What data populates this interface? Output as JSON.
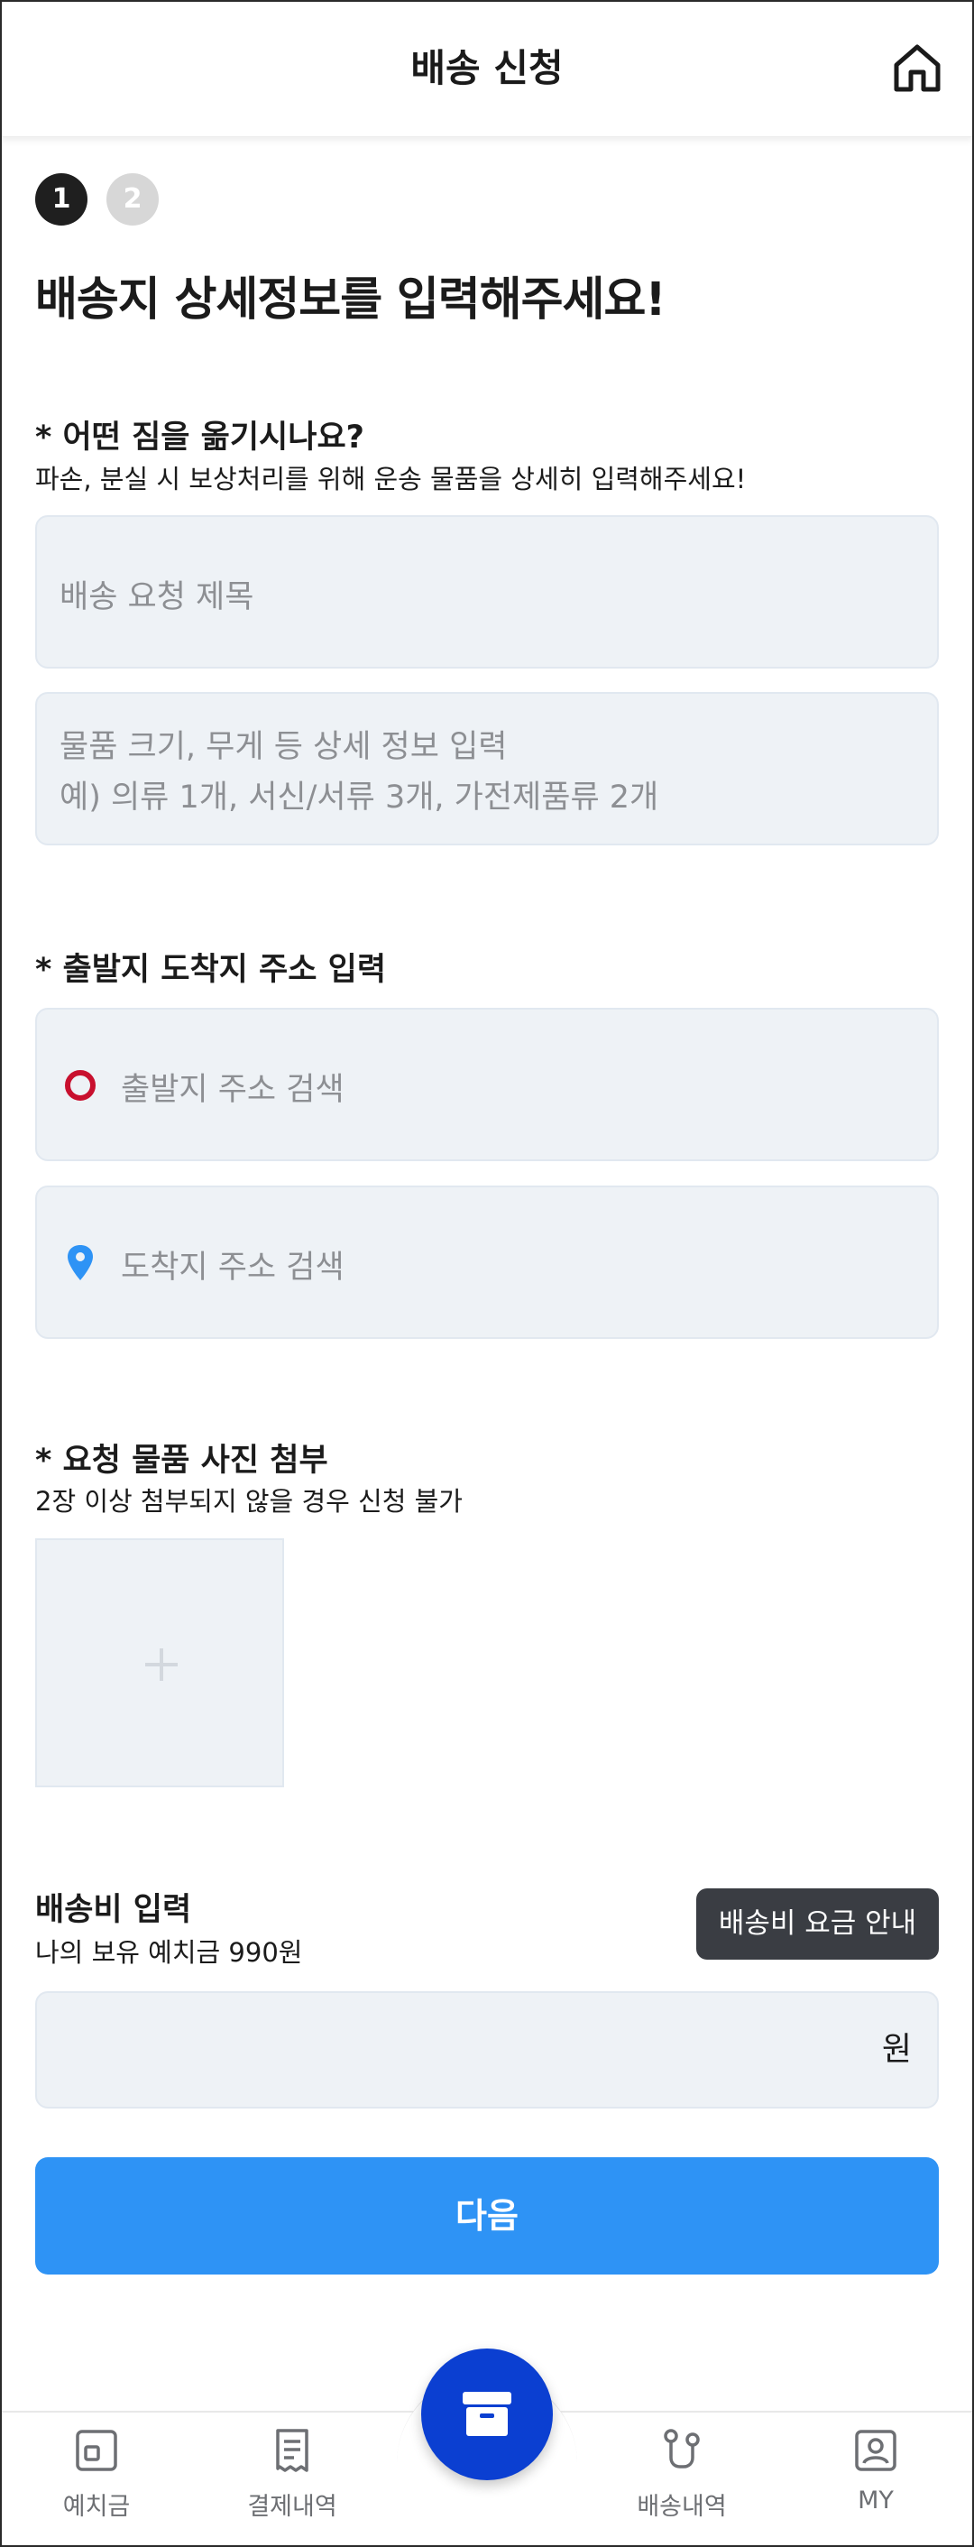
{
  "header": {
    "title": "배송 신청",
    "home_icon": "home-icon"
  },
  "steps": [
    "1",
    "2"
  ],
  "page_title": "배송지 상세정보를 입력해주세요!",
  "cargo": {
    "label": "* 어떤 짐을 옮기시나요?",
    "description": "파손, 분실 시 보상처리를 위해 운송 물품을 상세히 입력해주세요!",
    "title_placeholder": "배송 요청 제목",
    "detail_placeholder_line1": "물품 크기, 무게 등 상세 정보 입력",
    "detail_placeholder_line2": "예) 의류 1개, 서신/서류 3개, 가전제품류 2개"
  },
  "address": {
    "label": "* 출발지 도착지 주소 입력",
    "origin_placeholder": "출발지 주소 검색",
    "destination_placeholder": "도착지 주소 검색"
  },
  "photos": {
    "label": "* 요청 물품 사진 첨부",
    "description": "2장 이상 첨부되지 않을 경우 신청 불가"
  },
  "fee": {
    "label": "배송비 입력",
    "balance": "나의 보유 예치금 990원",
    "guide_button": "배송비 요금 안내",
    "unit": "원"
  },
  "next_button": "다음",
  "bottom_nav": {
    "items": [
      {
        "label": "예치금",
        "icon": "deposit-icon"
      },
      {
        "label": "결제내역",
        "icon": "receipt-icon"
      },
      {
        "label": "배송내역",
        "icon": "route-icon"
      },
      {
        "label": "MY",
        "icon": "profile-icon"
      }
    ],
    "center_icon": "box-icon"
  },
  "colors": {
    "primary": "#2e93f5",
    "center_button": "#0b3fd1",
    "origin_marker": "#c8102e",
    "destination_marker": "#2e93f5",
    "field_bg": "#eef2f6",
    "dark_button": "#3a3d43"
  }
}
